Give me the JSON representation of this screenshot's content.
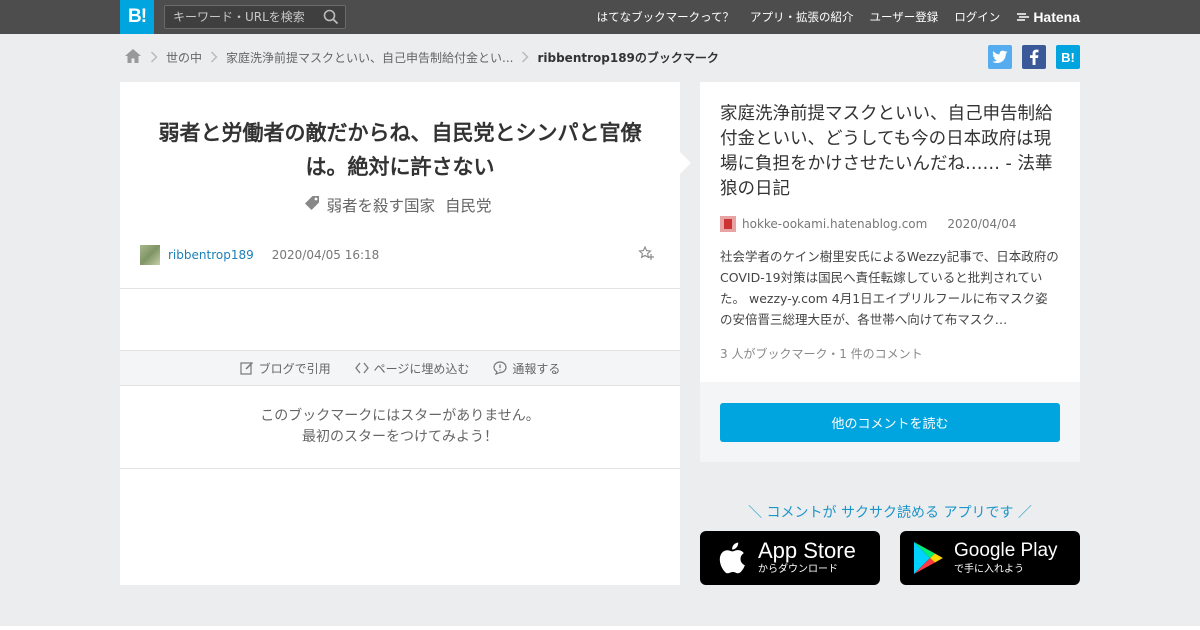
{
  "topbar": {
    "logo": "B!",
    "search_placeholder": "キーワード・URLを検索",
    "nav": [
      "はてなブックマークって？",
      "アプリ・拡張の紹介",
      "ユーザー登録",
      "ログイン"
    ],
    "brand": "Hatena"
  },
  "breadcrumb": {
    "items": [
      "世の中",
      "家庭洗浄前提マスクといい、自己申告制給付金とい..."
    ],
    "current": "ribbentrop189のブックマーク"
  },
  "share": {
    "hatena_label": "B!"
  },
  "bookmark": {
    "comment": "弱者と労働者の敵だからね、自民党とシンパと官僚は。絶対に許さない",
    "tags": [
      "弱者を殺す国家",
      "自民党"
    ],
    "user": "ribbentrop189",
    "timestamp": "2020/04/05 16:18",
    "actions": [
      "ブログで引用",
      "ページに埋め込む",
      "通報する"
    ],
    "no_star_line1": "このブックマークにはスターがありません。",
    "no_star_line2": "最初のスターをつけてみよう！"
  },
  "entry": {
    "title": "家庭洗浄前提マスクといい、自己申告制給付金といい、どうしても今の日本政府は現場に負担をかけさせたいんだね…… - 法華狼の日記",
    "domain": "hokke-ookami.hatenablog.com",
    "date": "2020/04/04",
    "summary": "社会学者のケイン樹里安氏によるWezzy記事で、日本政府のCOVID-19対策は国民へ責任転嫁していると批判されていた。 wezzy-y.com 4月1日エイプリルフールに布マスク姿の安倍晋三総理大臣が、各世帯へ向けて布マスク…",
    "meta": "3 人がブックマーク・1 件のコメント",
    "read_more": "他のコメントを読む"
  },
  "promo": {
    "tagline": "＼ コメントが サクサク読める アプリです ／",
    "appstore_big": "App Store",
    "appstore_small": "からダウンロード",
    "googleplay_big": "Google Play",
    "googleplay_small": "で手に入れよう"
  },
  "colors": {
    "accent": "#00a4de",
    "topbar": "#4d4d4d",
    "link": "#1d7fb8",
    "twitter": "#1da1f2",
    "facebook": "#3b5998"
  },
  "icons": [
    "home-icon",
    "search-icon",
    "tag-icon",
    "star-add-icon",
    "edit-icon",
    "code-icon",
    "report-icon",
    "apple-icon",
    "google-play-icon",
    "twitter-icon",
    "facebook-icon"
  ]
}
